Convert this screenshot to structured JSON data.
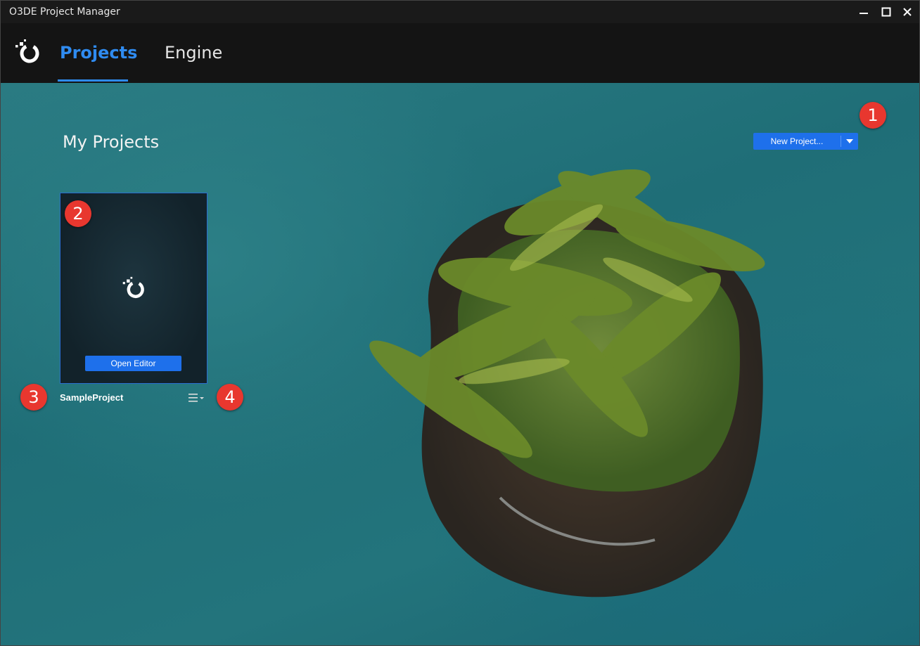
{
  "window": {
    "title": "O3DE Project Manager"
  },
  "header": {
    "tabs": [
      {
        "label": "Projects",
        "active": true
      },
      {
        "label": "Engine",
        "active": false
      }
    ],
    "accent_color": "#2f8bf0"
  },
  "main": {
    "section_title": "My Projects",
    "new_project_label": "New Project...",
    "projects": [
      {
        "name": "SampleProject",
        "open_editor_label": "Open Editor"
      }
    ]
  },
  "annotations": [
    "1",
    "2",
    "3",
    "4"
  ],
  "icons": {
    "logo": "o3de-logo-icon",
    "card_logo": "o3de-logo-icon",
    "project_menu": "hamburger-menu-icon",
    "dropdown": "chevron-down-icon"
  }
}
